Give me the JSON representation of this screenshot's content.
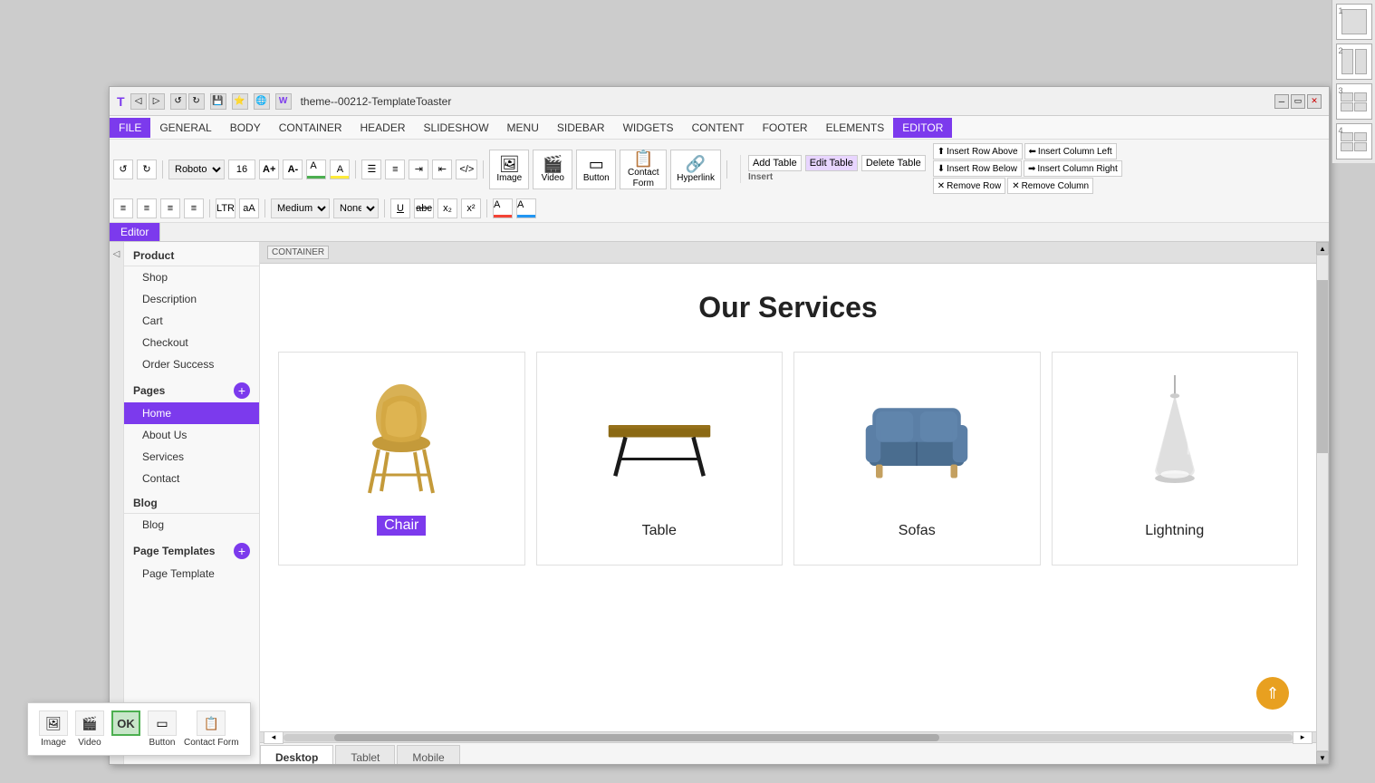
{
  "app": {
    "title": "theme--00212-TemplateToaster",
    "window_controls": [
      "minimize",
      "restore",
      "close"
    ]
  },
  "right_panel": {
    "items": [
      {
        "number": "1",
        "type": "single"
      },
      {
        "number": "2",
        "type": "double"
      },
      {
        "number": "3",
        "type": "quad"
      },
      {
        "number": "4",
        "type": "quad2"
      }
    ]
  },
  "menu_bar": {
    "items": [
      "FILE",
      "GENERAL",
      "BODY",
      "CONTAINER",
      "HEADER",
      "SLIDESHOW",
      "MENU",
      "SIDEBAR",
      "WIDGETS",
      "CONTENT",
      "FOOTER",
      "ELEMENTS",
      "EDITOR"
    ],
    "active": "EDITOR"
  },
  "toolbar": {
    "font": "Roboto",
    "size": "16",
    "format_size_label": "Medium",
    "none_label": "None",
    "undo_redo": "Undo Redo"
  },
  "table_toolbar": {
    "add_table": "Add Table",
    "edit_table": "Edit Table",
    "delete_table": "Delete Table",
    "insert_row_above": "Insert Row Above",
    "insert_row_below": "Insert Row Below",
    "remove_row": "Remove Row",
    "insert_col_left": "Insert Column Left",
    "insert_col_right": "Insert Column Right",
    "remove_column": "Remove Column",
    "section_label": "Insert"
  },
  "media_buttons": {
    "image": "Image",
    "video": "Video",
    "button": "Button",
    "contact_form": "Contact Form",
    "hyperlink": "Hyperlink"
  },
  "sidebar": {
    "product_section": "Product",
    "product_items": [
      "Shop",
      "Description",
      "Cart",
      "Checkout",
      "Order Success"
    ],
    "pages_section": "Pages",
    "pages_add_btn": "+",
    "pages_items": [
      {
        "label": "Home",
        "active": true
      },
      {
        "label": "About Us",
        "active": false
      },
      {
        "label": "Services",
        "active": false
      },
      {
        "label": "Contact",
        "active": false
      }
    ],
    "blog_section": "Blog",
    "blog_items": [
      "Blog"
    ],
    "templates_section": "Page Templates",
    "templates_add_btn": "+",
    "templates_items": [
      "Page Template"
    ]
  },
  "canvas": {
    "tag": "CONTAINER",
    "services_title": "Our Services",
    "cards": [
      {
        "label": "Chair",
        "selected": true
      },
      {
        "label": "Table",
        "selected": false
      },
      {
        "label": "Sofas",
        "selected": false
      },
      {
        "label": "Lightning",
        "selected": false
      }
    ]
  },
  "bottom_tabs": {
    "tabs": [
      "Desktop",
      "Tablet",
      "Mobile"
    ],
    "active": "Desktop"
  },
  "floating_toolbar": {
    "image_label": "Image",
    "video_label": "Video",
    "button_label": "Button",
    "contact_form_label": "Contact Form",
    "ok_label": "OK"
  },
  "back_to_top": "⇑"
}
